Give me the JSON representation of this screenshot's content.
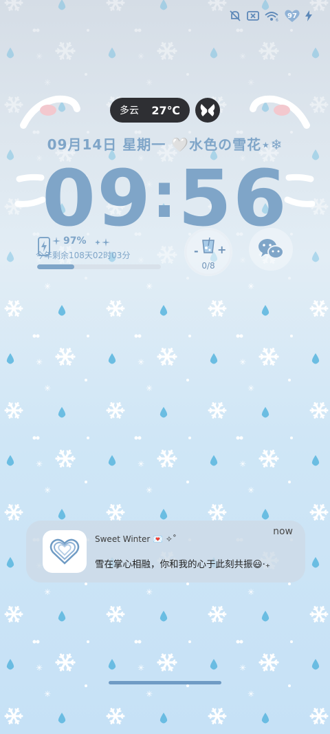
{
  "status_bar": {
    "battery_level": "97",
    "icons": [
      "muted-notification-icon",
      "no-sim-icon",
      "wifi-icon",
      "heart-battery-icon",
      "charging-bolt-icon"
    ]
  },
  "weather": {
    "condition": "多云",
    "temperature": "27℃"
  },
  "date_line": "09月14日  星期一 🤍水色の雪花⋆❄",
  "clock": {
    "hour": "09",
    "separator": ":",
    "minute": "56"
  },
  "battery_widget": {
    "percent": "97%",
    "year_remaining": "今年剩余108天02时03分",
    "year_progress": 0.3
  },
  "water_widget": {
    "minus": "-",
    "plus": "+",
    "count": "0/8"
  },
  "notification": {
    "app": "Sweet Winter 💌 ✧˚",
    "time": "now",
    "message": "雪在掌心相融，你和我的心于此刻共振😃‧₊"
  },
  "colors": {
    "accent": "#7fa5c8",
    "pill": "#2e2f33",
    "background": "#dde9f3"
  }
}
